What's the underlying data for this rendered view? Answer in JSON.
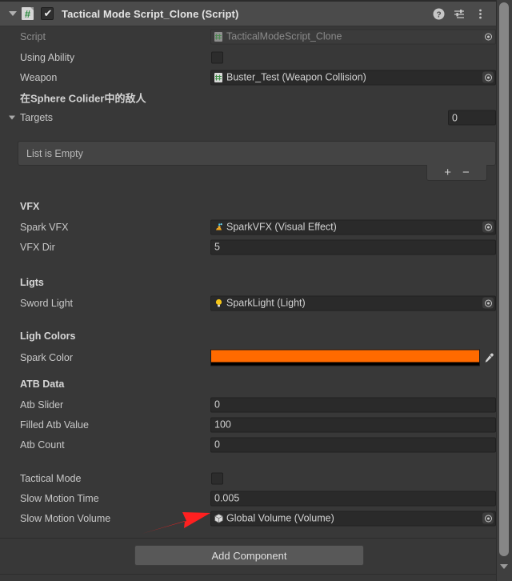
{
  "component": {
    "title": "Tactical Mode Script_Clone (Script)",
    "enabled_checkmark": "✔",
    "script_icon_glyph": "#",
    "header_icons": [
      {
        "name": "help-icon",
        "glyph": "?"
      },
      {
        "name": "preset-icon",
        "glyph": "preset"
      },
      {
        "name": "more-menu-icon",
        "glyph": "⋮"
      }
    ]
  },
  "fields": {
    "script": {
      "label": "Script",
      "value": "TacticalModeScript_Clone",
      "icon": "script-asset-icon"
    },
    "using_ability": {
      "label": "Using Ability",
      "checked": false
    },
    "weapon": {
      "label": "Weapon",
      "value": "Buster_Test (Weapon Collision)",
      "icon": "script-asset-icon"
    }
  },
  "targets_section": {
    "note": "在Sphere Colider中的敌人",
    "label": "Targets",
    "size": "0",
    "list_empty_text": "List is Empty",
    "add_label": "+",
    "remove_label": "−"
  },
  "vfx_section": {
    "header": "VFX",
    "spark_vfx": {
      "label": "Spark VFX",
      "value": "SparkVFX (Visual Effect)",
      "icon": "vfx-graph-icon"
    },
    "vfx_dir": {
      "label": "VFX Dir",
      "value": "5"
    }
  },
  "lights_section": {
    "header": "Ligts",
    "sword_light": {
      "label": "Sword Light",
      "value": "SparkLight (Light)",
      "icon": "light-bulb-icon"
    }
  },
  "light_colors_section": {
    "header": "Ligh Colors",
    "spark_color": {
      "label": "Spark Color",
      "color": "#FF6A00",
      "alpha_color": "#000000",
      "eyedropper": "⚲"
    }
  },
  "atb_section": {
    "header": "ATB Data",
    "atb_slider": {
      "label": "Atb Slider",
      "value": "0"
    },
    "filled_atb_value": {
      "label": "Filled Atb Value",
      "value": "100"
    },
    "atb_count": {
      "label": "Atb Count",
      "value": "0"
    }
  },
  "tactical_section": {
    "tactical_mode": {
      "label": "Tactical Mode",
      "checked": false
    },
    "slow_motion_time": {
      "label": "Slow Motion Time",
      "value": "0.005"
    },
    "slow_motion_volume": {
      "label": "Slow Motion Volume",
      "value": "Global Volume (Volume)",
      "icon": "gameobject-cube-icon"
    }
  },
  "footer": {
    "add_component_label": "Add Component"
  },
  "annotation": {
    "arrow_color": "#FF2020"
  },
  "scrollbar": {
    "thumb_color": "#868686"
  }
}
